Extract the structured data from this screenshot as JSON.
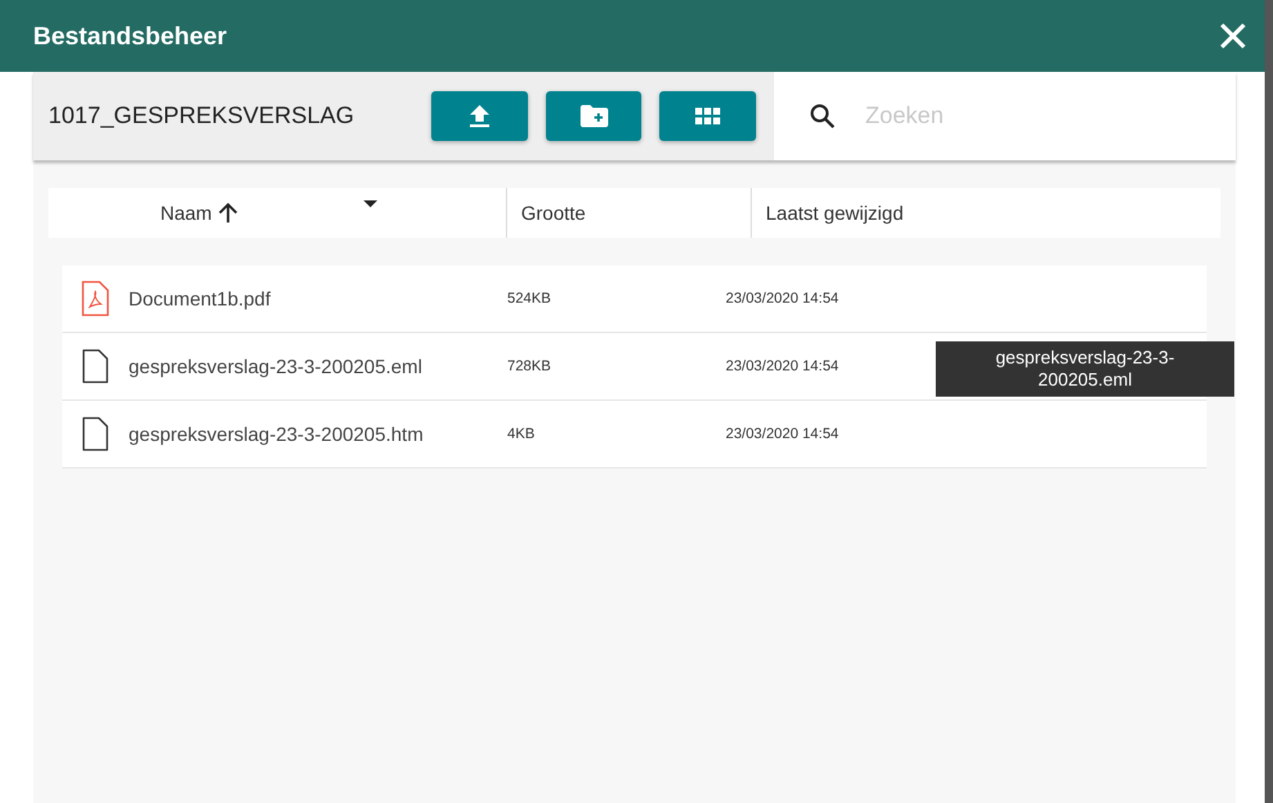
{
  "window": {
    "title": "Bestandsbeheer"
  },
  "folder": "1017_GESPREKSVERSLAG",
  "search": {
    "placeholder": "Zoeken"
  },
  "columns": [
    {
      "label": "Naam",
      "sorted": true
    },
    {
      "label": "Grootte",
      "sorted": false
    },
    {
      "label": "Laatst gewijzigd",
      "sorted": false
    }
  ],
  "files": [
    {
      "kind": "pdf",
      "name": "Document1b.pdf",
      "size": "524KB",
      "modified": "23/03/2020 14:54"
    },
    {
      "kind": "file",
      "name": "gespreksverslag-23-3-200205.eml",
      "size": "728KB",
      "modified": "23/03/2020 14:54",
      "tooltip": [
        "gespreksverslag-23-3-",
        "200205.eml"
      ]
    },
    {
      "kind": "file",
      "name": "gespreksverslag-23-3-200205.htm",
      "size": "4KB",
      "modified": "23/03/2020 14:54"
    }
  ]
}
